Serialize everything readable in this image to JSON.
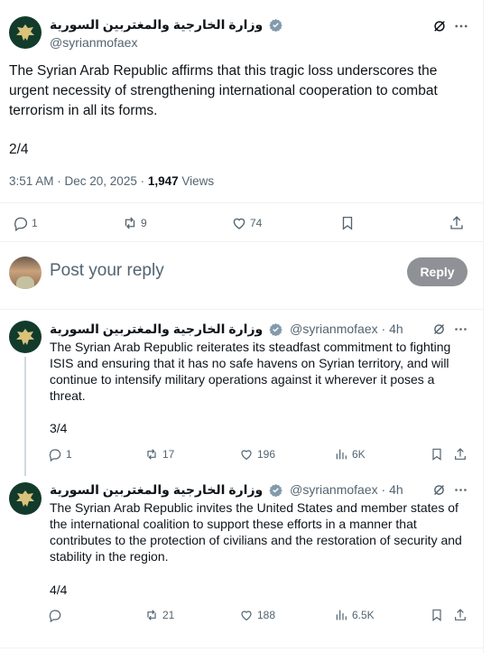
{
  "main_post": {
    "display_name": "وزارة الخارجية والمغتربين السورية",
    "handle": "@syrianmofaex",
    "text": "The Syrian Arab Republic affirms that this tragic loss underscores the urgent necessity of strengthening international cooperation to combat terrorism in all its forms.",
    "counter": "2/4",
    "time": "3:51 AM · Dec 20, 2025 · ",
    "views_count": "1,947",
    "views_label": " Views",
    "replies": "1",
    "reposts": "9",
    "likes": "74"
  },
  "composer": {
    "placeholder": "Post your reply",
    "button": "Reply"
  },
  "replies": [
    {
      "display_name": "وزارة الخارجية والمغتربين السورية",
      "handle": "@syrianmofaex · 4h",
      "text": "The Syrian Arab Republic reiterates its steadfast commitment to fighting ISIS and ensuring that it has no safe havens on Syrian territory, and will continue to intensify military operations against it wherever it poses a threat.",
      "counter": "3/4",
      "replies": "1",
      "reposts": "17",
      "likes": "196",
      "views": "6K"
    },
    {
      "display_name": "وزارة الخارجية والمغتربين السورية",
      "handle": "@syrianmofaex · 4h",
      "text": "The Syrian Arab Republic invites the United States and member states of the international coalition to support these efforts in a manner that contributes to the protection of civilians and the restoration of security and stability in the region.",
      "counter": "4/4",
      "replies": "",
      "reposts": "21",
      "likes": "188",
      "views": "6.5K"
    }
  ],
  "colors": {
    "text": "#0f1419",
    "muted": "#536471",
    "verified": "#829aab",
    "avatar_bg": "#123b2b",
    "reply_button": "#8e9195"
  },
  "icons": [
    "eagle-emblem",
    "verified-badge",
    "grok-icon",
    "more-icon",
    "reply-icon",
    "repost-icon",
    "like-icon",
    "bookmark-icon",
    "share-icon",
    "views-icon"
  ]
}
